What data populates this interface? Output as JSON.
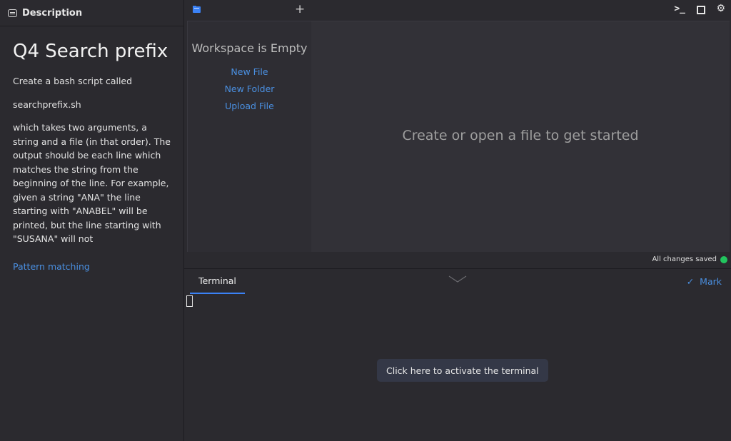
{
  "description": {
    "header": "Description",
    "title": "Q4 Search prefix",
    "paragraphs": [
      "Create a bash script called",
      "searchprefix.sh",
      "which takes two arguments, a string and a file (in that order). The output should be each line which matches the string from the beginning of the line. For example, given a string \"ANA\" the line starting with \"ANABEL\" will be printed, but the line starting with \"SUSANA\" will not"
    ],
    "tag_link": "Pattern matching"
  },
  "toolbar": {
    "plus": "+",
    "terminal_icon": ">_",
    "gear": "⚙"
  },
  "workspace": {
    "empty_title": "Workspace is Empty",
    "new_file": "New File",
    "new_folder": "New Folder",
    "upload_file": "Upload File"
  },
  "editor": {
    "placeholder": "Create or open a file to get started"
  },
  "status": {
    "saved": "All changes saved",
    "color": "#22c55e"
  },
  "terminal": {
    "tab": "Terminal",
    "mark": "Mark",
    "activate": "Click here to activate the terminal"
  },
  "colors": {
    "accent": "#3b82f6",
    "link": "#4a8fe0"
  }
}
